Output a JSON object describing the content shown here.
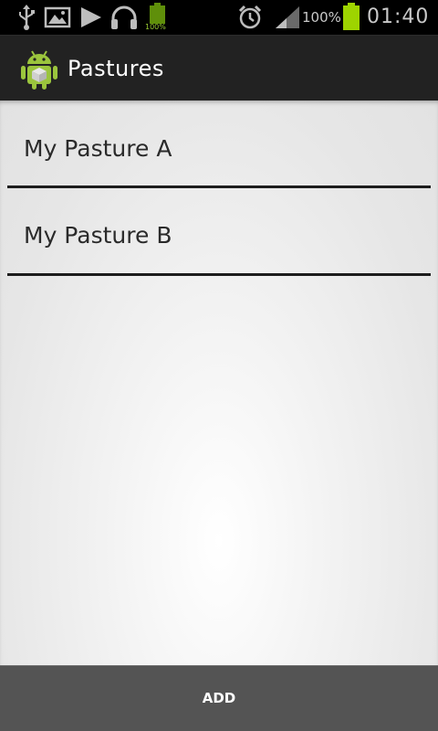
{
  "status_bar": {
    "battery_percent": "100%",
    "mini_battery_label": "100%",
    "time": "01:40",
    "icons": [
      "usb-icon",
      "gallery-icon",
      "play-icon",
      "headphones-icon",
      "battery-small-icon",
      "alarm-icon",
      "signal-icon",
      "battery-icon"
    ],
    "colors": {
      "battery": "#9ed400",
      "icon": "#bdbdbd"
    }
  },
  "action_bar": {
    "title": "Pastures",
    "icon": "android-app-icon",
    "colors": {
      "icon_green": "#9bc53d",
      "background": "#222222"
    }
  },
  "pastures": [
    {
      "label": "My Pasture A"
    },
    {
      "label": "My Pasture B"
    }
  ],
  "bottom_bar": {
    "add_label": "ADD"
  }
}
